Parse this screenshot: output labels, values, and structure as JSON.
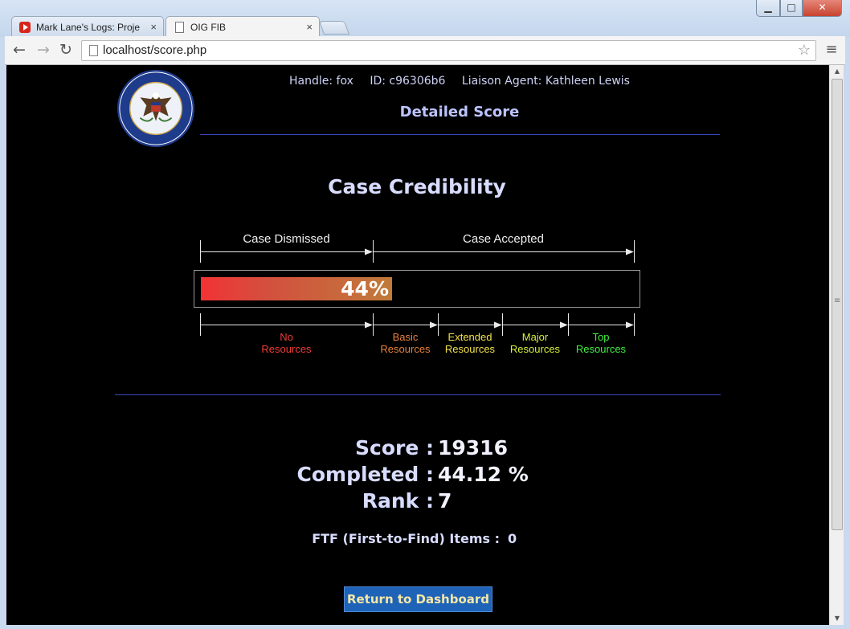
{
  "browser": {
    "tabs": [
      {
        "title": "Mark Lane's Logs: Proje",
        "close": "×"
      },
      {
        "title": "OIG FIB",
        "close": "×"
      }
    ],
    "url": "localhost/score.php",
    "window_controls": {
      "minimize": "▁",
      "maximize": "□",
      "close": "✕"
    }
  },
  "header": {
    "handle": "Handle: fox",
    "id": "ID: c96306b6",
    "liaison": "Liaison Agent: Kathleen Lewis",
    "title": "Detailed Score"
  },
  "credibility": {
    "title": "Case Credibility",
    "ranges": {
      "dismissed": "Case Dismissed",
      "accepted": "Case Accepted"
    },
    "percent_label": "44%",
    "percent": 44,
    "resources": [
      {
        "line1": "No",
        "line2": "Resources",
        "color": "#f03b35"
      },
      {
        "line1": "Basic",
        "line2": "Resources",
        "color": "#e8813a"
      },
      {
        "line1": "Extended",
        "line2": "Resources",
        "color": "#f2e24a"
      },
      {
        "line1": "Major",
        "line2": "Resources",
        "color": "#d7f03a"
      },
      {
        "line1": "Top",
        "line2": "Resources",
        "color": "#3ef03e"
      }
    ]
  },
  "stats": {
    "score_label": "Score :",
    "score_value": "19316",
    "completed_label": "Completed :",
    "completed_value": "44.12 %",
    "rank_label": "Rank :",
    "rank_value": "7",
    "ftf_label": "FTF (First-to-Find) Items :",
    "ftf_value": "0"
  },
  "actions": {
    "dashboard": "Return to Dashboard"
  },
  "colors": {
    "background": "#000000",
    "accent": "#3a46b8",
    "button": "#1e63b8",
    "button_text": "#f5e7a6"
  },
  "icons": [
    "back-icon",
    "forward-icon",
    "reload-icon",
    "star-icon",
    "menu-icon",
    "oig-seal-logo"
  ]
}
